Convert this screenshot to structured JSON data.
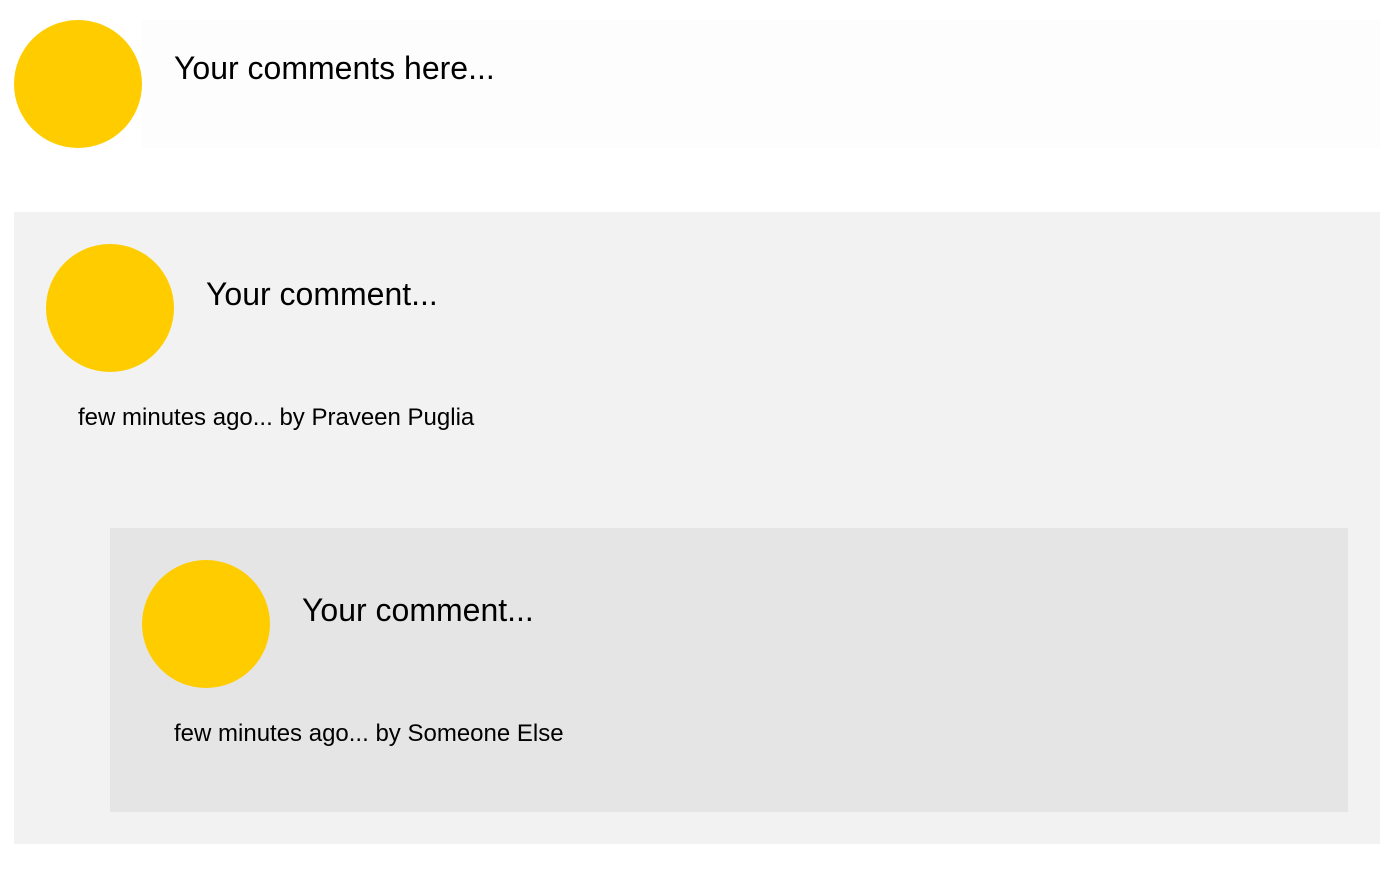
{
  "colors": {
    "avatar": "#ffcc00",
    "composer_bg": "#fdfdfd",
    "comment_bg": "#f2f2f2",
    "reply_bg": "#e5e5e5"
  },
  "composer": {
    "placeholder": "Your comments here..."
  },
  "comments": [
    {
      "body": "Your comment...",
      "time": "few minutes ago...",
      "by_label": "by",
      "author": "Praveen Puglia",
      "replies": [
        {
          "body": "Your comment...",
          "time": "few minutes ago...",
          "by_label": "by",
          "author": "Someone Else"
        }
      ]
    }
  ]
}
